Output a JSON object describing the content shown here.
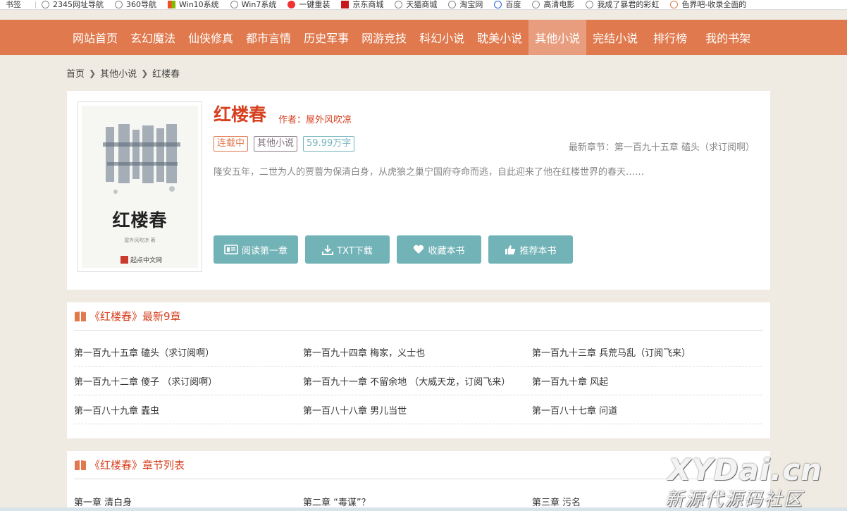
{
  "bookmarks": {
    "folder_label": "书签",
    "items": [
      "2345网址导航",
      "360导航",
      "Win10系统",
      "Win7系统",
      "一键重装",
      "京东商城",
      "天猫商城",
      "淘宝网",
      "百度",
      "高清电影",
      "我成了暴君的彩虹",
      "色界吧-收录全面的"
    ]
  },
  "nav": {
    "items": [
      "网站首页",
      "玄幻魔法",
      "仙侠修真",
      "都市言情",
      "历史军事",
      "网游竞技",
      "科幻小说",
      "耽美小说",
      "其他小说",
      "完结小说",
      "排行榜",
      "我的书架"
    ],
    "active_index": 8,
    "bg_color": "#e0794d"
  },
  "breadcrumb": {
    "home": "首页",
    "category": "其他小说",
    "current": "红楼春"
  },
  "book": {
    "title": "红楼春",
    "author": "作者：屋外风吹凉",
    "status_tag": "连载中",
    "category_tag": "其他小说",
    "words_tag": "59.99万字",
    "latest_chapter": "最新章节：第一百九十五章 磕头（求订阅啊）",
    "intro": "隆安五年，二世为人的贾蔷为保清白身，从虎狼之巢宁国府夺命而逃，自此迎来了他在红楼世界的春天……",
    "cover": {
      "title": "红楼春",
      "author": "屋外风吹凉 著",
      "publisher": "起点中文网"
    },
    "accent_color": "#d6401f"
  },
  "actions": {
    "read_first": "阅读第一章",
    "txt_download": "TXT下载",
    "bookmark": "收藏本书",
    "recommend": "推荐本书",
    "btn_color": "#72b3b8"
  },
  "latest_section": {
    "title": "《红楼春》最新9章",
    "chapters": [
      "第一百九十五章 磕头（求订阅啊）",
      "第一百九十四章 梅家，义士也",
      "第一百九十三章 兵荒马乱（订阅飞来）",
      "第一百九十二章 傻子 （求订阅啊）",
      "第一百九十一章 不留余地 （大威天龙，订阅飞来）",
      "第一百九十章 风起",
      "第一百八十九章 蠹虫",
      "第一百八十八章 男儿当世",
      "第一百八十七章 问道"
    ]
  },
  "list_section": {
    "title": "《红楼春》章节列表",
    "chapters": [
      "第一章 清白身",
      "第二章 “毒谋”？",
      "第三章 污名"
    ]
  },
  "watermark": {
    "top": "XYDai.cn",
    "bottom": "新源代源码社区"
  }
}
